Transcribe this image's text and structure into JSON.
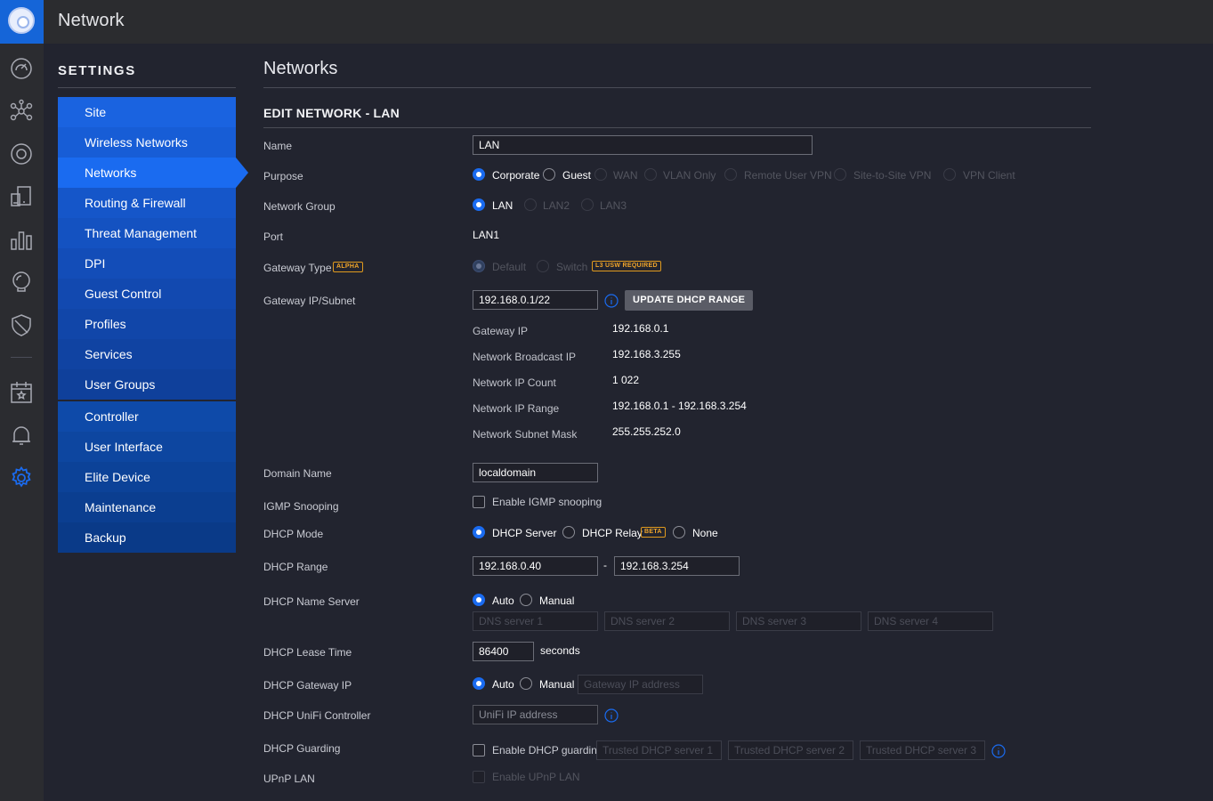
{
  "app": {
    "title": "Network"
  },
  "settings": {
    "title": "SETTINGS",
    "nav_group_1": [
      "Site",
      "Wireless Networks",
      "Networks",
      "Routing & Firewall",
      "Threat Management",
      "DPI",
      "Guest Control",
      "Profiles",
      "Services",
      "User Groups"
    ],
    "nav_group_2": [
      "Controller",
      "User Interface",
      "Elite Device",
      "Maintenance",
      "Backup"
    ],
    "active_item": "Networks"
  },
  "rail_icons": [
    "dashboard-icon",
    "topology-icon",
    "devices-icon",
    "clients-icon",
    "statistics-icon",
    "insights-icon",
    "threat-icon",
    "events-icon",
    "alerts-icon",
    "settings-icon"
  ],
  "page": {
    "title": "Networks",
    "section_title": "EDIT NETWORK - LAN"
  },
  "form": {
    "name": {
      "label": "Name",
      "value": "LAN"
    },
    "purpose": {
      "label": "Purpose",
      "options": [
        "Corporate",
        "Guest",
        "WAN",
        "VLAN Only",
        "Remote User VPN",
        "Site-to-Site VPN",
        "VPN Client"
      ],
      "selected": "Corporate"
    },
    "network_group": {
      "label": "Network Group",
      "options": [
        "LAN",
        "LAN2",
        "LAN3"
      ],
      "selected": "LAN"
    },
    "port": {
      "label": "Port",
      "value": "LAN1"
    },
    "gateway_type": {
      "label": "Gateway Type",
      "badge": "ALPHA",
      "options": [
        "Default",
        "Switch"
      ],
      "selected": "Default",
      "switch_badge": "L3 USW REQUIRED"
    },
    "gateway_ip_subnet": {
      "label": "Gateway IP/Subnet",
      "value": "192.168.0.1/22",
      "button": "UPDATE DHCP RANGE"
    },
    "subnet_info": {
      "gateway_ip": {
        "label": "Gateway IP",
        "value": "192.168.0.1"
      },
      "broadcast_ip": {
        "label": "Network Broadcast IP",
        "value": "192.168.3.255"
      },
      "ip_count": {
        "label": "Network IP Count",
        "value": "1 022"
      },
      "ip_range": {
        "label": "Network IP Range",
        "value": "192.168.0.1 - 192.168.3.254"
      },
      "subnet_mask": {
        "label": "Network Subnet Mask",
        "value": "255.255.252.0"
      }
    },
    "domain_name": {
      "label": "Domain Name",
      "value": "localdomain"
    },
    "igmp_snooping": {
      "label": "IGMP Snooping",
      "checkbox_label": "Enable IGMP snooping",
      "checked": false
    },
    "dhcp_mode": {
      "label": "DHCP Mode",
      "options": [
        "DHCP Server",
        "DHCP Relay",
        "None"
      ],
      "relay_badge": "BETA",
      "selected": "DHCP Server"
    },
    "dhcp_range": {
      "label": "DHCP Range",
      "start": "192.168.0.40",
      "separator": "-",
      "end": "192.168.3.254"
    },
    "dhcp_name_server": {
      "label": "DHCP Name Server",
      "options": [
        "Auto",
        "Manual"
      ],
      "selected": "Auto",
      "placeholders": [
        "DNS server 1",
        "DNS server 2",
        "DNS server 3",
        "DNS server 4"
      ]
    },
    "dhcp_lease_time": {
      "label": "DHCP Lease Time",
      "value": "86400",
      "unit": "seconds"
    },
    "dhcp_gateway_ip": {
      "label": "DHCP Gateway IP",
      "options": [
        "Auto",
        "Manual"
      ],
      "selected": "Auto",
      "placeholder": "Gateway IP address"
    },
    "dhcp_unifi_controller": {
      "label": "DHCP UniFi Controller",
      "placeholder": "UniFi IP address"
    },
    "dhcp_guarding": {
      "label": "DHCP Guarding",
      "checkbox_label": "Enable DHCP guarding",
      "checked": false,
      "placeholders": [
        "Trusted DHCP server 1",
        "Trusted DHCP server 2",
        "Trusted DHCP server 3"
      ]
    },
    "upnp_lan": {
      "label": "UPnP LAN",
      "checkbox_label": "Enable UPnP LAN",
      "checked": false
    }
  },
  "colors": {
    "accent": "#1a6bf0",
    "background": "#22242f",
    "badge": "#f0a52a"
  }
}
